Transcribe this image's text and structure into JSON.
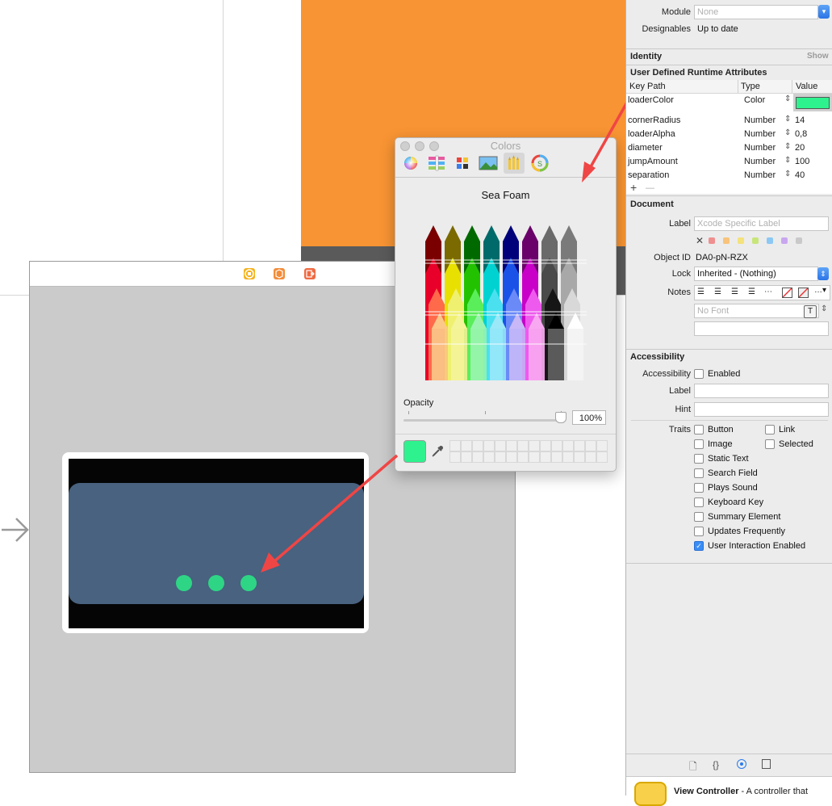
{
  "colors": {
    "orange": "#f89433",
    "sea_foam": "#2ef28e",
    "dot_green": "#2ed585",
    "loader_blue": "#48627f",
    "arrow_red": "#f04545"
  },
  "canvas": {
    "scene_icons": [
      "view-controller-icon",
      "first-responder-icon",
      "exit-icon"
    ]
  },
  "colors_panel": {
    "title": "Colors",
    "tabs": [
      "color-wheel",
      "color-sliders",
      "color-palettes",
      "image-palettes",
      "crayons",
      "spectrum-plugin"
    ],
    "selected_tab": "crayons",
    "color_name": "Sea Foam",
    "opacity_label": "Opacity",
    "opacity_value": "100%",
    "opacity_fraction": 1.0
  },
  "inspector": {
    "module_label": "Module",
    "module_value": "None",
    "designables_label": "Designables",
    "designables_value": "Up to date",
    "identity_title": "Identity",
    "identity_show": "Show",
    "udra_title": "User Defined Runtime Attributes",
    "col_keypath": "Key Path",
    "col_type": "Type",
    "col_value": "Value",
    "attributes": [
      {
        "key": "loaderColor",
        "type": "Color",
        "value": ""
      },
      {
        "key": "cornerRadius",
        "type": "Number",
        "value": "14"
      },
      {
        "key": "loaderAlpha",
        "type": "Number",
        "value": "0,8"
      },
      {
        "key": "diameter",
        "type": "Number",
        "value": "20"
      },
      {
        "key": "jumpAmount",
        "type": "Number",
        "value": "100"
      },
      {
        "key": "separation",
        "type": "Number",
        "value": "40"
      }
    ],
    "add_symbol": "+",
    "remove_symbol": "—",
    "document_title": "Document",
    "doc_label_label": "Label",
    "doc_label_placeholder": "Xcode Specific Label",
    "object_id_label": "Object ID",
    "object_id_value": "DA0-pN-RZX",
    "lock_label": "Lock",
    "lock_value": "Inherited - (Nothing)",
    "notes_label": "Notes",
    "font_placeholder": "No Font",
    "accessibility_title": "Accessibility",
    "acc_label": "Accessibility",
    "acc_enabled": "Enabled",
    "acc_label_label": "Label",
    "hint_label": "Hint",
    "traits_label": "Traits",
    "traits_left": [
      {
        "label": "Button",
        "checked": false
      },
      {
        "label": "Image",
        "checked": false
      },
      {
        "label": "Static Text",
        "checked": false
      },
      {
        "label": "Search Field",
        "checked": false
      },
      {
        "label": "Plays Sound",
        "checked": false
      },
      {
        "label": "Keyboard Key",
        "checked": false
      },
      {
        "label": "Summary Element",
        "checked": false
      },
      {
        "label": "Updates Frequently",
        "checked": false
      },
      {
        "label": "User Interaction Enabled",
        "checked": true
      }
    ],
    "traits_right": [
      {
        "label": "Link",
        "checked": false
      },
      {
        "label": "Selected",
        "checked": false
      }
    ],
    "label_colors": [
      "#f08f8f",
      "#f8c37a",
      "#f4e27a",
      "#c8e57a",
      "#8cc8f4",
      "#c9a7ef",
      "#c9c9c9"
    ],
    "library_title": "View Controller",
    "library_desc": "- A controller that"
  }
}
